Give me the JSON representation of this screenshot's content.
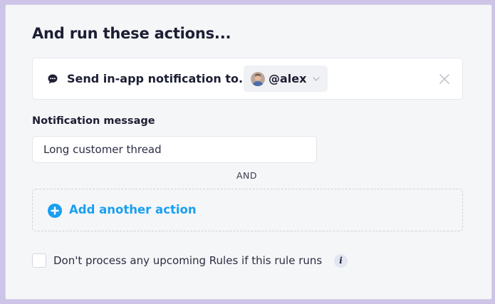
{
  "section": {
    "heading": "And run these actions..."
  },
  "action": {
    "label": "Send in-app notification to...",
    "icon": "chat-bubble-icon",
    "recipient": "@alex",
    "close_icon": "close-icon"
  },
  "notification": {
    "label": "Notification message",
    "value": "Long customer thread"
  },
  "connector": "AND",
  "add_action": {
    "label": "Add another action",
    "icon": "plus-circle-icon"
  },
  "stop_rules": {
    "label": "Don't process any upcoming Rules if this rule runs",
    "checked": false,
    "info": "i"
  },
  "colors": {
    "accent": "#1a9ff0",
    "text": "#1c1e33",
    "panel": "#f5f6f8",
    "backdrop": "#cdc4e8"
  }
}
